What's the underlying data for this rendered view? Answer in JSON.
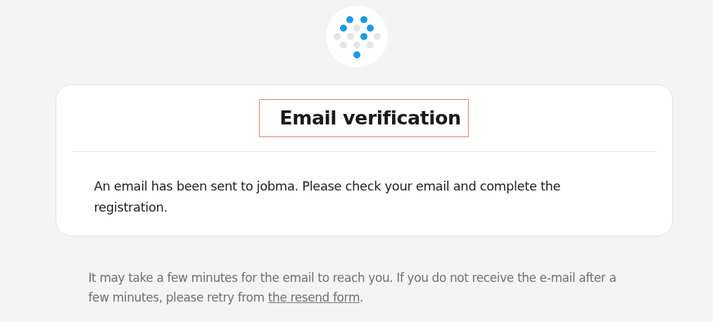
{
  "card": {
    "title": "Email verification",
    "message": "An email has been sent to jobma. Please check your email and complete the registration."
  },
  "note": {
    "text": "It may take a few minutes for the email to reach you. If you do not receive the e-mail after a few minutes, please retry from ",
    "link": "the resend form",
    "after": "."
  }
}
